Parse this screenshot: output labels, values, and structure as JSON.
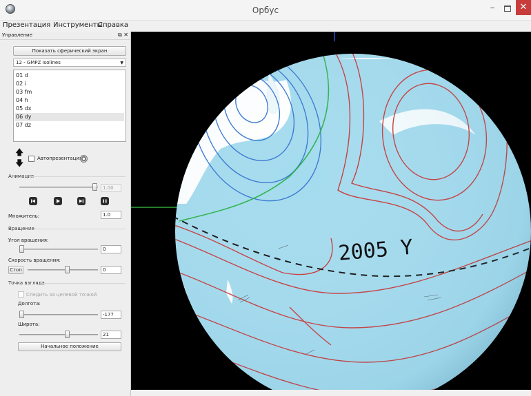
{
  "window": {
    "title": "Орбус",
    "icon": "globe-app-icon",
    "minimize_icon": "minimize-icon",
    "maximize_icon": "maximize-icon",
    "close_icon": "close-icon"
  },
  "menu": [
    "Презентация",
    "Инструменты",
    "Справка"
  ],
  "panel": {
    "title": "Управление",
    "float_icon": "float-icon",
    "close_icon": "close-icon",
    "show_sphere_button": "Показать сферический экран",
    "dataset_select": "12 - GMPZ Isolines",
    "list_items": [
      "01 d",
      "02 i",
      "03 fm",
      "04 h",
      "05 dx",
      "06 dy",
      "07 dz"
    ],
    "selected_item": "06 dy",
    "move_up_icon": "arrow-up-icon",
    "move_down_icon": "arrow-down-icon",
    "autopresentation_label": "Автопрезентация",
    "autopresentation_checked": false,
    "settings_icon": "gear-icon"
  },
  "animation": {
    "title": "Анимация",
    "slider_value": "1.00",
    "slider_fraction": 0.98,
    "controls": [
      "skip-back-icon",
      "play-icon",
      "skip-forward-icon",
      "stop-icon"
    ],
    "multiplier_label": "Множитель:",
    "multiplier_value": "1.0"
  },
  "rotation": {
    "title": "Вращение",
    "angle_label": "Угол вращения:",
    "angle_value": "0",
    "angle_fraction": 0.0,
    "speed_label": "Скорость вращения:",
    "stop_button": "Стоп",
    "speed_value": "0",
    "speed_fraction": 0.5
  },
  "viewpoint": {
    "title": "Точка взгляда",
    "follow_label": "Следить за целевой точкой",
    "follow_checked": false,
    "longitude_label": "Долгота:",
    "longitude_value": "-177",
    "longitude_fraction": 0.0,
    "latitude_label": "Широта:",
    "latitude_value": "21",
    "latitude_fraction": 0.5,
    "reset_button": "Начальное положение"
  },
  "globe": {
    "year_label": "2005 Y",
    "ocean_color": "#a4dbee",
    "land_color": "#ffffff",
    "background_color": "#000000",
    "contour_colors": [
      "#c83838",
      "#3a78d2",
      "#2cb24a"
    ]
  }
}
